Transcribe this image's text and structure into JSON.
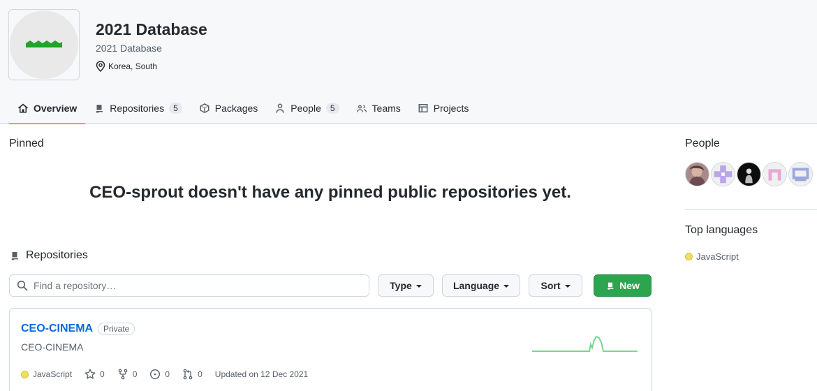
{
  "org": {
    "name": "2021 Database",
    "description": "2021 Database",
    "location": "Korea, South",
    "avatar_icon": "green-zigzag-logo"
  },
  "tabs": [
    {
      "label": "Overview",
      "icon": "home-icon",
      "active": true
    },
    {
      "label": "Repositories",
      "icon": "repo-icon",
      "count": "5"
    },
    {
      "label": "Packages",
      "icon": "package-icon"
    },
    {
      "label": "People",
      "icon": "person-icon",
      "count": "5"
    },
    {
      "label": "Teams",
      "icon": "people-icon"
    },
    {
      "label": "Projects",
      "icon": "table-icon"
    }
  ],
  "pinned": {
    "label": "Pinned",
    "empty_message": "CEO-sprout doesn't have any pinned public repositories yet."
  },
  "repositories": {
    "heading": "Repositories",
    "search_placeholder": "Find a repository…",
    "type_label": "Type",
    "language_label": "Language",
    "sort_label": "Sort",
    "new_label": "New",
    "items": [
      {
        "name": "CEO-CINEMA",
        "visibility": "Private",
        "description": "CEO-CINEMA",
        "language": "JavaScript",
        "language_color": "#f1e05a",
        "stars": "0",
        "forks": "0",
        "issues": "0",
        "pulls": "0",
        "updated": "Updated on 12 Dec 2021"
      }
    ]
  },
  "sidebar": {
    "people_label": "People",
    "people_avatars": [
      "avatar-photo",
      "avatar-purple-cross",
      "avatar-dark-figure",
      "avatar-pink-arch",
      "avatar-blue-window"
    ],
    "top_languages_label": "Top languages",
    "languages": [
      {
        "name": "JavaScript",
        "color": "#f1e05a"
      }
    ]
  },
  "colors": {
    "accent_tab": "#fd8c73",
    "link": "#0969da",
    "new_button": "#2da44e",
    "sparkline": "#9be9a8"
  }
}
